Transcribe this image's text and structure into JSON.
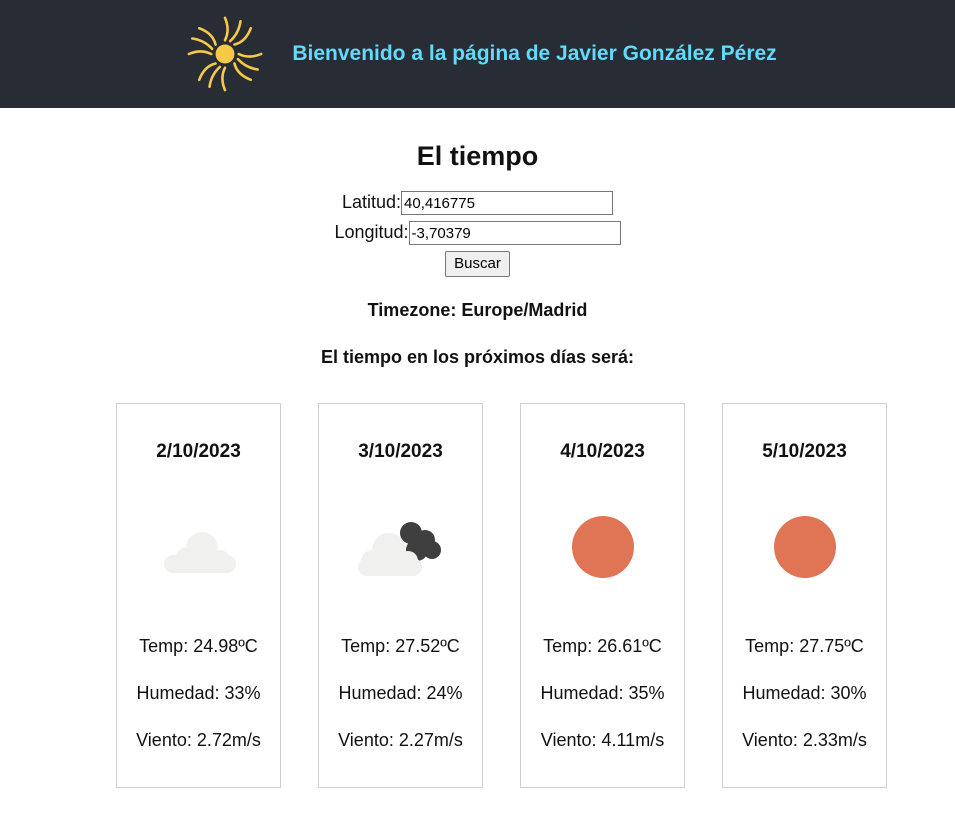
{
  "header": {
    "title": "Bienvenido a la página de Javier González Pérez"
  },
  "page": {
    "title": "El tiempo"
  },
  "form": {
    "lat_label": "Latitud:",
    "lat_value": "40,416775",
    "lon_label": "Longitud:",
    "lon_value": "-3,70379",
    "search_label": "Buscar"
  },
  "timezone": "Timezone: Europe/Madrid",
  "forecast_heading": "El tiempo en los próximos días será:",
  "days": [
    {
      "date": "2/10/2023",
      "icon": "cloud-icon",
      "temp": "Temp: 24.98ºC",
      "humidity": "Humedad: 33%",
      "wind": "Viento: 2.72m/s"
    },
    {
      "date": "3/10/2023",
      "icon": "cloud-dark-cloud-icon",
      "temp": "Temp: 27.52ºC",
      "humidity": "Humedad: 24%",
      "wind": "Viento: 2.27m/s"
    },
    {
      "date": "4/10/2023",
      "icon": "sun-icon",
      "temp": "Temp: 26.61ºC",
      "humidity": "Humedad: 35%",
      "wind": "Viento: 4.11m/s"
    },
    {
      "date": "5/10/2023",
      "icon": "sun-icon",
      "temp": "Temp: 27.75ºC",
      "humidity": "Humedad: 30%",
      "wind": "Viento: 2.33m/s"
    }
  ],
  "colors": {
    "header_bg": "#282c34",
    "header_text": "#61dafb",
    "sun": "#e07555",
    "logo": "#f7c948"
  }
}
